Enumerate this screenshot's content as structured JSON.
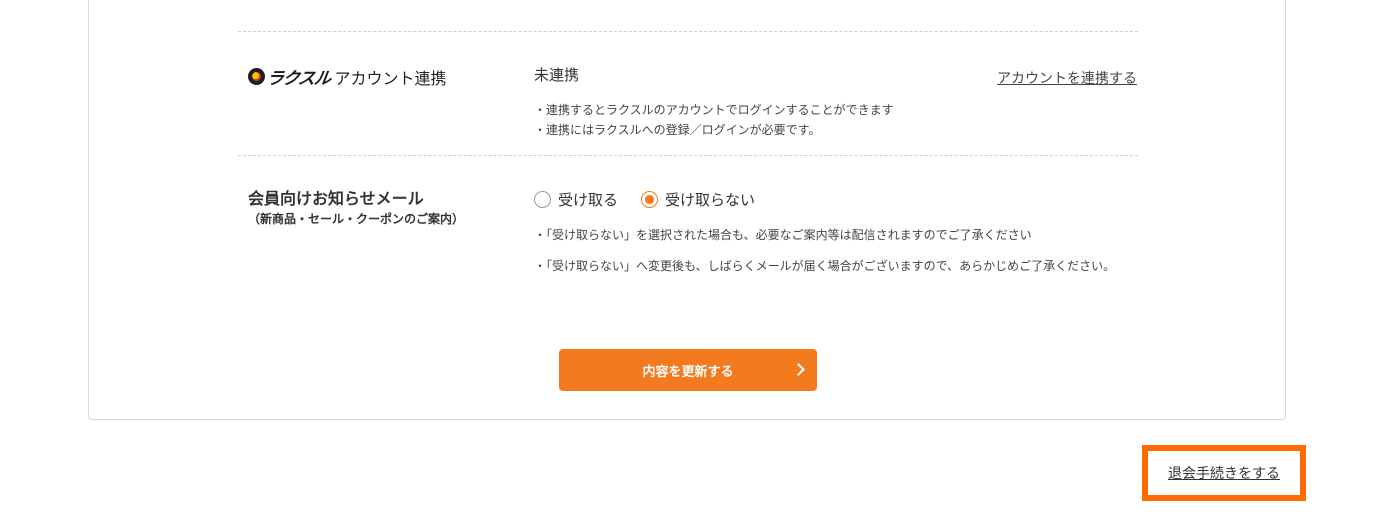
{
  "account_link": {
    "brand": "ラクスル",
    "label": "アカウント連携",
    "status": "未連携",
    "action_link": "アカウントを連携する",
    "notes": [
      "・連携するとラクスルのアカウントでログインすることができます",
      "・連携にはラクスルへの登録／ログインが必要です。"
    ]
  },
  "newsletter": {
    "title": "会員向けお知らせメール",
    "subtitle": "（新商品・セール・クーポンのご案内）",
    "options": [
      {
        "label": "受け取る",
        "checked": false
      },
      {
        "label": "受け取らない",
        "checked": true
      }
    ],
    "notes": [
      "・「受け取らない」を選択された場合も、必要なご案内等は配信されますのでご了承ください",
      "・「受け取らない」へ変更後も、しばらくメールが届く場合がございますので、あらかじめご了承ください。"
    ]
  },
  "update_button": {
    "label": "内容を更新する"
  },
  "withdraw": {
    "label": "退会手続きをする"
  },
  "colors": {
    "accent": "#f37a1f",
    "highlight_border": "#ff6a00"
  }
}
